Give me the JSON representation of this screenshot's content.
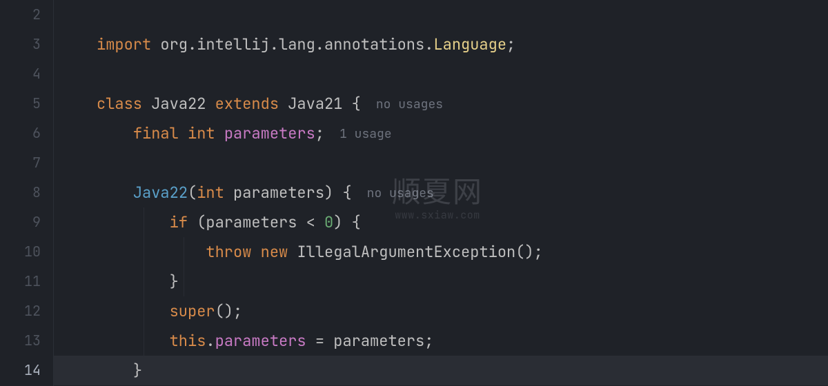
{
  "gutter": {
    "lines": [
      "2",
      "3",
      "4",
      "5",
      "6",
      "7",
      "8",
      "9",
      "10",
      "11",
      "12",
      "13",
      "14"
    ],
    "currentLine": "14"
  },
  "hints": {
    "noUsages": "no usages",
    "oneUsage": "1 usage"
  },
  "code": {
    "importKw": "import",
    "importPkg": "org.intellij.lang.annotations.",
    "importCls": "Language",
    "classKw": "class",
    "className": "Java22",
    "extendsKw": "extends",
    "superClass": "Java21",
    "finalKw": "final",
    "intKw": "int",
    "fieldName": "parameters",
    "ctorName": "Java22",
    "paramName": "parameters",
    "ifKw": "if",
    "ltZeroNum": "0",
    "throwKw": "throw",
    "newKw": "new",
    "exceptionCls": "IllegalArgumentException",
    "superCall": "super",
    "thisKw": "this",
    "assignField": "parameters",
    "assignRhs": "parameters"
  },
  "watermark": {
    "big": "顺夏网",
    "small": "www.sxiaw.com"
  }
}
